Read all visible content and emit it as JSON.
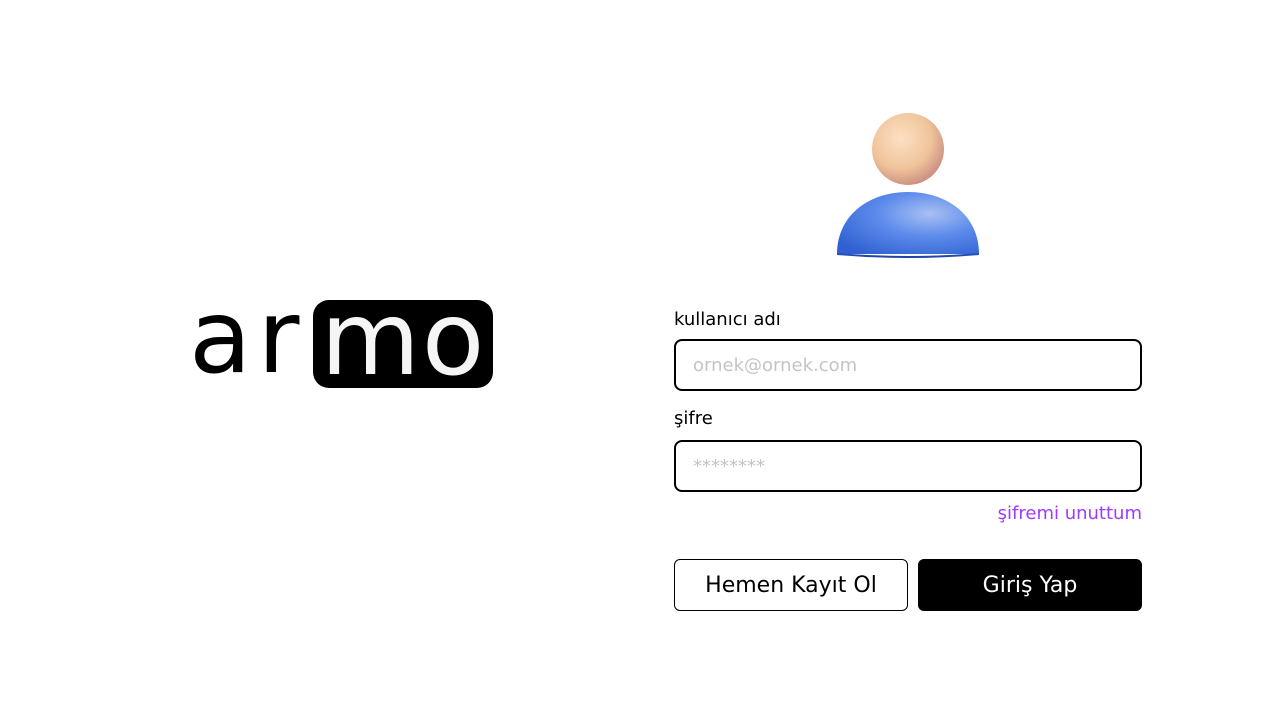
{
  "logo": {
    "plain_text": "ar",
    "boxed_text": "mo"
  },
  "avatar": {
    "icon": "user-avatar-icon",
    "head_color": "#f0c49c",
    "body_color": "#4a7ee8"
  },
  "form": {
    "username_label": "kullanıcı adı",
    "username_placeholder": "ornek@ornek.com",
    "username_value": "",
    "password_label": "şifre",
    "password_placeholder": "********",
    "password_value": "",
    "forgot_password": "şifremi unuttum",
    "register_button": "Hemen Kayıt Ol",
    "login_button": "Giriş Yap"
  },
  "colors": {
    "accent_link": "#9b3bff",
    "primary_button": "#000000",
    "border": "#000000",
    "placeholder": "#c4c4c4"
  }
}
